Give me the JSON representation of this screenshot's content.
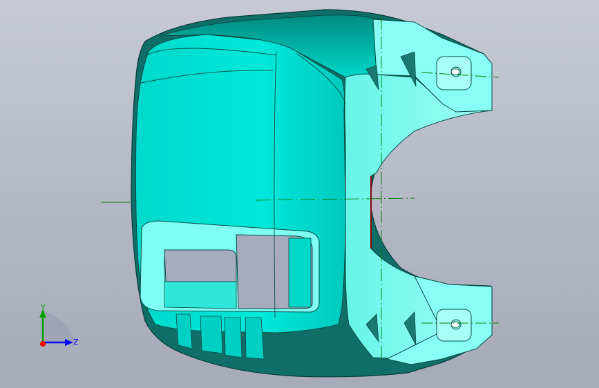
{
  "viewport": {
    "background_top": "#c7cad6",
    "background_bottom": "#a6aab9"
  },
  "model": {
    "body_color": "#00e0d2",
    "body_shade": "#00c3b7",
    "inner_color": "#7ffff2",
    "edge_color": "#0a3a36",
    "centerline_color": "#008000",
    "hidden_edge_color": "#8b0000"
  },
  "triad": {
    "y_label": "Y",
    "z_label": "Z",
    "y_color": "#00a000",
    "z_color": "#0000ff",
    "x_color": "#ff0000",
    "icons": [
      "axis-triad-icon"
    ]
  }
}
